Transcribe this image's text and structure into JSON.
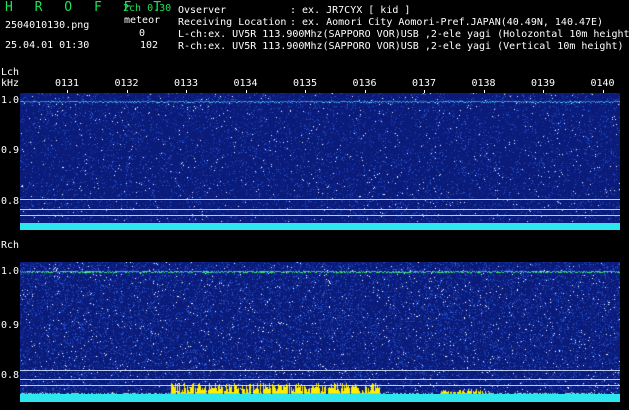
{
  "header": {
    "logo": "H R O F F T",
    "mode": "2ch 0.30",
    "filename": "2504010130.png",
    "meteor_label": "meteor",
    "meteor_count_l": "0",
    "meteor_count_r": "102",
    "timestamp": "25.04.01 01:30",
    "observer_label": "Ovserver",
    "observer_value": ": ex. JR7CYX [ kid ]",
    "location_label": "Receiving Location",
    "location_value": ": ex. Aomori City Aomori-Pref.JAPAN(40.49N, 140.47E)",
    "lch_line": "L-ch:ex. UV5R 113.900Mhz(SAPPORO VOR)USB ,2-ele yagi (Holozontal 10m height",
    "rch_line": "R-ch:ex. UV5R 113.900Mhz(SAPPORO VOR)USB ,2-ele yagi (Vertical 10m height)"
  },
  "time_ticks": [
    "0131",
    "0132",
    "0133",
    "0134",
    "0135",
    "0136",
    "0137",
    "0138",
    "0139",
    "0140"
  ],
  "lch": {
    "label": "Lch",
    "unit": "kHz",
    "y_ticks": [
      "1.0",
      "0.9",
      "0.8"
    ]
  },
  "rch": {
    "label": "Rch",
    "y_ticks": [
      "1.0",
      "0.9",
      "0.8"
    ]
  },
  "colors": {
    "background": "#000000",
    "panel": "#0a1b7a",
    "label_green": "#19e35a",
    "cyan_band": "#2ee6ee",
    "meteor_yellow": "#ffee00"
  }
}
